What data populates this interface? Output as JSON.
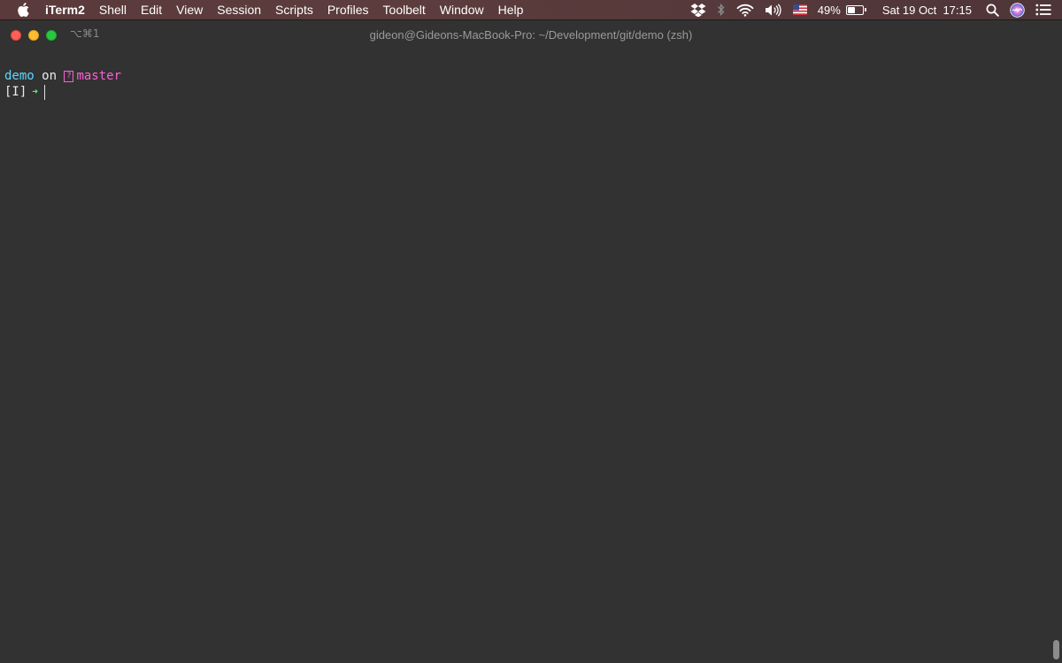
{
  "menubar": {
    "apple_icon": "apple-logo-icon",
    "app_name": "iTerm2",
    "items": [
      "Shell",
      "Edit",
      "View",
      "Session",
      "Scripts",
      "Profiles",
      "Toolbelt",
      "Window",
      "Help"
    ],
    "status": {
      "dropbox_icon": "dropbox-icon",
      "bluetooth_icon": "bluetooth-icon",
      "wifi_icon": "wifi-icon",
      "volume_icon": "volume-icon",
      "input_source_icon": "us-flag-icon",
      "battery_percent": "49%",
      "battery_level": 0.49,
      "datetime": "Sat 19 Oct  17:15",
      "spotlight_icon": "search-icon",
      "siri_icon": "siri-icon",
      "notification_icon": "notification-center-icon"
    }
  },
  "window": {
    "shortcut": "⌥⌘1",
    "title": "gideon@Gideons-MacBook-Pro: ~/Development/git/demo (zsh)"
  },
  "terminal": {
    "line1": {
      "dir": "demo",
      "on": " on ",
      "branch_symbol": "?",
      "branch": "master"
    },
    "line2": {
      "mode": "[I]",
      "arrow": "➜"
    }
  },
  "colors": {
    "dir": "#5fd7ff",
    "branch": "#ff5fd7",
    "arrow": "#5fff5f",
    "background": "#323232"
  }
}
